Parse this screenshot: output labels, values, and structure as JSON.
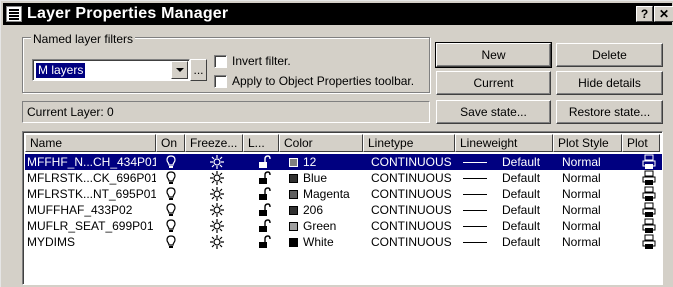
{
  "window": {
    "title": "Layer Properties Manager",
    "help_label": "?",
    "close_label": "✕"
  },
  "filters": {
    "group_label": "Named layer filters",
    "selected_filter": "M layers",
    "ellipsis_label": "...",
    "invert_label": "Invert filter.",
    "invert_checked": false,
    "apply_label": "Apply to Object Properties toolbar.",
    "apply_checked": false
  },
  "buttons": {
    "new": "New",
    "delete": "Delete",
    "current": "Current",
    "hide_details": "Hide details",
    "save_state": "Save state...",
    "restore_state": "Restore state..."
  },
  "current_layer": {
    "label": "Current Layer:  0"
  },
  "list": {
    "columns": [
      "Name",
      "On",
      "Freeze...",
      "L...",
      "Color",
      "Linetype",
      "Lineweight",
      "Plot Style",
      "Plot"
    ],
    "rows": [
      {
        "name": "MFFHF_N...CH_434P01",
        "color_name": "12",
        "color_hex": "#808080",
        "linetype": "CONTINUOUS",
        "lineweight": "Default",
        "plot_style": "Normal",
        "selected": true
      },
      {
        "name": "MFLRSTK...CK_696P01",
        "color_name": "Blue",
        "color_hex": "#303030",
        "linetype": "CONTINUOUS",
        "lineweight": "Default",
        "plot_style": "Normal",
        "selected": false
      },
      {
        "name": "MFLRSTK...NT_695P01",
        "color_name": "Magenta",
        "color_hex": "#606060",
        "linetype": "CONTINUOUS",
        "lineweight": "Default",
        "plot_style": "Normal",
        "selected": false
      },
      {
        "name": "MUFFHAF_433P02",
        "color_name": "206",
        "color_hex": "#303030",
        "linetype": "CONTINUOUS",
        "lineweight": "Default",
        "plot_style": "Normal",
        "selected": false
      },
      {
        "name": "MUFLR_SEAT_699P01",
        "color_name": "Green",
        "color_hex": "#a0a0a0",
        "linetype": "CONTINUOUS",
        "lineweight": "Default",
        "plot_style": "Normal",
        "selected": false
      },
      {
        "name": "MYDIMS",
        "color_name": "White",
        "color_hex": "#000000",
        "linetype": "CONTINUOUS",
        "lineweight": "Default",
        "plot_style": "Normal",
        "selected": false
      }
    ]
  },
  "icons": {
    "layer_on": "lightbulb-icon",
    "freeze": "sun-icon",
    "lock": "open-padlock-icon",
    "plot": "printer-icon"
  }
}
